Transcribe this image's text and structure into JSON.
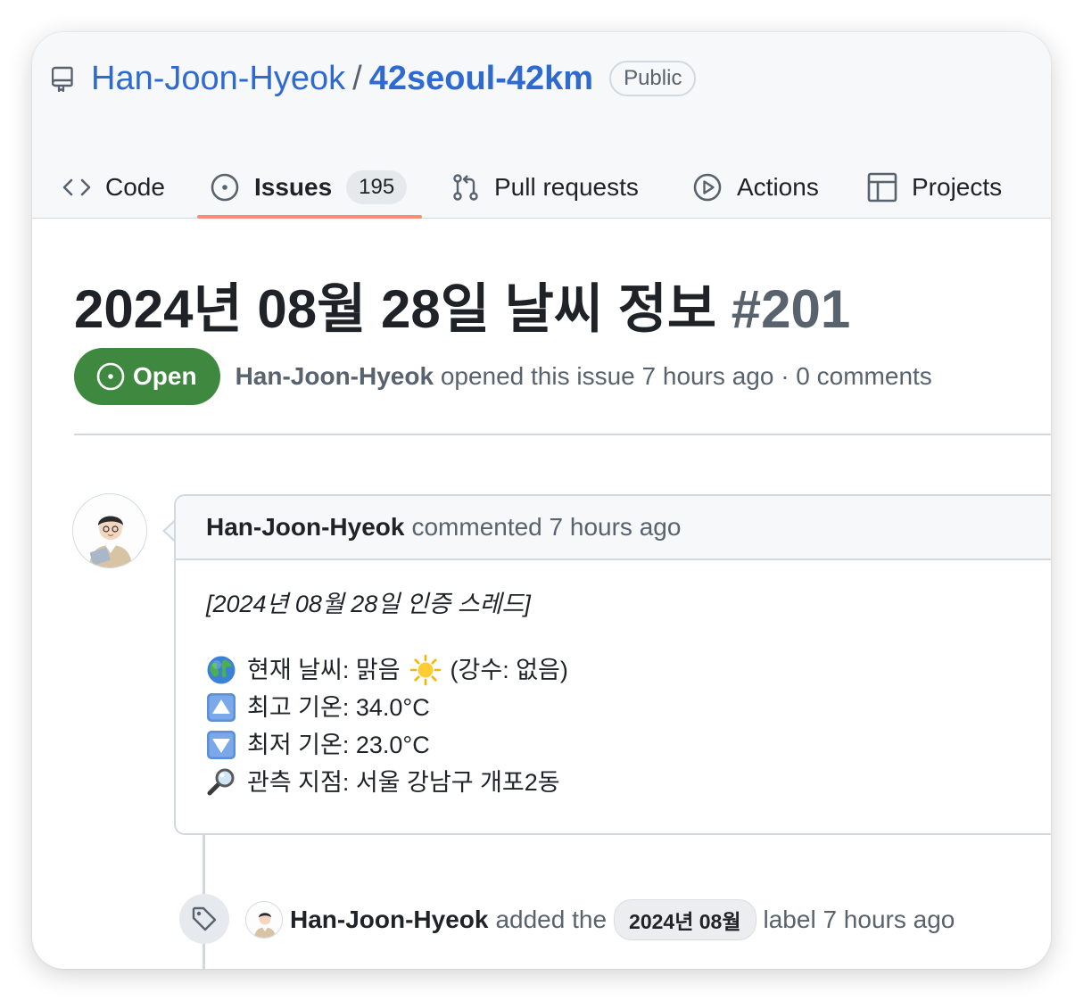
{
  "repo": {
    "owner": "Han-Joon-Hyeok",
    "separator": "/",
    "name": "42seoul-42km",
    "visibility": "Public"
  },
  "tabs": [
    {
      "label": "Code",
      "icon": "code-icon"
    },
    {
      "label": "Issues",
      "icon": "issue-opened-icon",
      "count": "195",
      "active": true
    },
    {
      "label": "Pull requests",
      "icon": "git-pull-request-icon"
    },
    {
      "label": "Actions",
      "icon": "play-icon"
    },
    {
      "label": "Projects",
      "icon": "table-icon"
    }
  ],
  "issue": {
    "title": "2024년 08월 28일 날씨 정보",
    "number": "#201",
    "state": "Open",
    "author": "Han-Joon-Hyeok",
    "opened_text": "opened this issue 7 hours ago · 0 comments"
  },
  "comment": {
    "author": "Han-Joon-Hyeok",
    "action_text": "commented 7 hours ago",
    "thread_title": "[2024년 08월 28일 인증 스레드]",
    "weather_prefix": "현재 날씨: 맑음",
    "weather_suffix": "(강수: 없음)",
    "max_temp": "최고 기온: 34.0°C",
    "min_temp": "최저 기온: 23.0°C",
    "location": "관측 지점: 서울 강남구 개포2동",
    "emojis": [
      "globe-icon",
      "sun-icon",
      "up-arrow-button-icon",
      "down-arrow-button-icon",
      "magnifying-glass-icon"
    ]
  },
  "event": {
    "author": "Han-Joon-Hyeok",
    "action_text": "added the",
    "label": "2024년 08월",
    "suffix_text": "label 7 hours ago",
    "icon": "tag-icon"
  },
  "colors": {
    "link": "#2f6ad0",
    "open_green": "#3f8840",
    "tab_underline": "#fd8c73",
    "muted_text": "#59636e",
    "border": "#d1d9e0"
  }
}
